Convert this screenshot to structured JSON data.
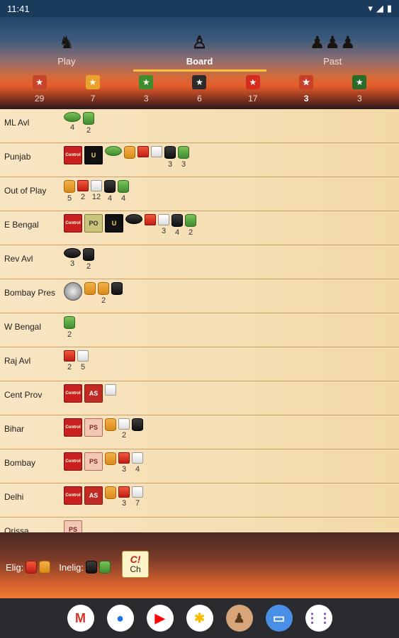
{
  "status": {
    "time": "11:41"
  },
  "tabs": [
    {
      "label": "Play",
      "icon": "soldier-icon"
    },
    {
      "label": "Board",
      "icon": "leader-icon"
    },
    {
      "label": "Past",
      "icon": "crowd-icon"
    }
  ],
  "counters": [
    {
      "value": "29",
      "color": "#c4452a",
      "icon": "red-faction-icon"
    },
    {
      "value": "7",
      "color": "#e9a22c",
      "icon": "orange-faction-icon"
    },
    {
      "value": "3",
      "color": "#3f8b2e",
      "icon": "green-faction-icon"
    },
    {
      "value": "6",
      "color": "#2b2b2b",
      "icon": "black-faction-icon"
    },
    {
      "value": "17",
      "color": "#d42c1e",
      "icon": "red-crown-icon"
    },
    {
      "value": "3",
      "color": "#c8402a",
      "icon": "flag-congress-icon"
    },
    {
      "value": "3",
      "color": "#2a6b2a",
      "icon": "flag-league-icon"
    }
  ],
  "rows": [
    {
      "name": "ML Avl",
      "pieces": [
        {
          "kind": "disk",
          "color": "green",
          "count": "4"
        },
        {
          "kind": "cyl",
          "color": "green",
          "count": "2"
        }
      ]
    },
    {
      "name": "Punjab",
      "pieces": [
        {
          "kind": "card",
          "style": "control",
          "label": "Control"
        },
        {
          "kind": "card",
          "style": "unrest",
          "label": "U"
        },
        {
          "kind": "disk",
          "color": "green",
          "count": ""
        },
        {
          "kind": "cyl",
          "color": "orange",
          "count": ""
        },
        {
          "kind": "cube",
          "color": "red",
          "count": ""
        },
        {
          "kind": "cube",
          "color": "white",
          "count": ""
        },
        {
          "kind": "cyl",
          "color": "black",
          "count": "3"
        },
        {
          "kind": "cyl",
          "color": "green",
          "count": "3"
        }
      ]
    },
    {
      "name": "Out of Play",
      "pieces": [
        {
          "kind": "cyl",
          "color": "orange",
          "count": "5"
        },
        {
          "kind": "cube",
          "color": "red",
          "count": "2"
        },
        {
          "kind": "cube",
          "color": "white",
          "count": "12"
        },
        {
          "kind": "cyl",
          "color": "black",
          "count": "4"
        },
        {
          "kind": "cyl",
          "color": "green",
          "count": "4"
        }
      ]
    },
    {
      "name": "E Bengal",
      "pieces": [
        {
          "kind": "card",
          "style": "control",
          "label": "Control"
        },
        {
          "kind": "card",
          "style": "po",
          "label": "PO"
        },
        {
          "kind": "card",
          "style": "unrest",
          "label": "U"
        },
        {
          "kind": "disk",
          "color": "black",
          "count": ""
        },
        {
          "kind": "cube",
          "color": "red",
          "count": ""
        },
        {
          "kind": "cube",
          "color": "white",
          "count": "3"
        },
        {
          "kind": "cyl",
          "color": "black",
          "count": "4"
        },
        {
          "kind": "cyl",
          "color": "green",
          "count": "2"
        }
      ]
    },
    {
      "name": "Rev Avl",
      "pieces": [
        {
          "kind": "disk",
          "color": "black",
          "count": "3"
        },
        {
          "kind": "cyl",
          "color": "black",
          "count": "2"
        }
      ]
    },
    {
      "name": "Bombay Pres",
      "pieces": [
        {
          "kind": "card",
          "style": "leader",
          "label": ""
        },
        {
          "kind": "cyl",
          "color": "orange",
          "count": ""
        },
        {
          "kind": "cyl",
          "color": "orange",
          "count": "2"
        },
        {
          "kind": "cyl",
          "color": "black",
          "count": ""
        }
      ]
    },
    {
      "name": "W Bengal",
      "pieces": [
        {
          "kind": "cyl",
          "color": "green",
          "count": "2"
        }
      ]
    },
    {
      "name": "Raj Avl",
      "pieces": [
        {
          "kind": "cube",
          "color": "red",
          "count": "2"
        },
        {
          "kind": "cube",
          "color": "white",
          "count": "5"
        }
      ]
    },
    {
      "name": "Cent Prov",
      "pieces": [
        {
          "kind": "card",
          "style": "control",
          "label": "Control"
        },
        {
          "kind": "card",
          "style": "as",
          "label": "AS"
        },
        {
          "kind": "cube",
          "color": "white",
          "count": ""
        }
      ]
    },
    {
      "name": "Bihar",
      "pieces": [
        {
          "kind": "card",
          "style": "control",
          "label": "Control"
        },
        {
          "kind": "card",
          "style": "ps",
          "label": "PS"
        },
        {
          "kind": "cyl",
          "color": "orange",
          "count": ""
        },
        {
          "kind": "cube",
          "color": "white",
          "count": "2"
        },
        {
          "kind": "cyl",
          "color": "black",
          "count": ""
        }
      ]
    },
    {
      "name": "Bombay",
      "pieces": [
        {
          "kind": "card",
          "style": "control",
          "label": "Control"
        },
        {
          "kind": "card",
          "style": "ps",
          "label": "PS"
        },
        {
          "kind": "cyl",
          "color": "orange",
          "count": ""
        },
        {
          "kind": "cube",
          "color": "red",
          "count": "3"
        },
        {
          "kind": "cube",
          "color": "white",
          "count": "4"
        }
      ]
    },
    {
      "name": "Delhi",
      "pieces": [
        {
          "kind": "card",
          "style": "control",
          "label": "Control"
        },
        {
          "kind": "card",
          "style": "as",
          "label": "AS"
        },
        {
          "kind": "cyl",
          "color": "orange",
          "count": ""
        },
        {
          "kind": "cube",
          "color": "red",
          "count": "3"
        },
        {
          "kind": "cube",
          "color": "white",
          "count": "7"
        }
      ]
    },
    {
      "name": "Orissa",
      "pieces": [
        {
          "kind": "card",
          "style": "ps",
          "label": "PS"
        }
      ]
    }
  ],
  "bottom": {
    "elig_label": "Elig:",
    "inelig_label": "Inelig:",
    "card_line1": "C!",
    "card_line2": "Ch"
  },
  "dock": [
    {
      "name": "gmail-icon",
      "glyph": "M",
      "bg": "#ffffff",
      "fg": "#d93025"
    },
    {
      "name": "chrome-icon",
      "glyph": "●",
      "bg": "#ffffff",
      "fg": "#1a73e8"
    },
    {
      "name": "youtube-icon",
      "glyph": "▶",
      "bg": "#ffffff",
      "fg": "#ff0000"
    },
    {
      "name": "photos-icon",
      "glyph": "✱",
      "bg": "#ffffff",
      "fg": "#fbbc04"
    },
    {
      "name": "game-app-icon",
      "glyph": "♟",
      "bg": "#d8a57a",
      "fg": "#5a3a1a"
    },
    {
      "name": "messages-icon",
      "glyph": "▭",
      "bg": "#4a8fe7",
      "fg": "#ffffff"
    },
    {
      "name": "app-drawer-icon",
      "glyph": "⋮⋮",
      "bg": "#ffffff",
      "fg": "#6b3fb3"
    }
  ]
}
